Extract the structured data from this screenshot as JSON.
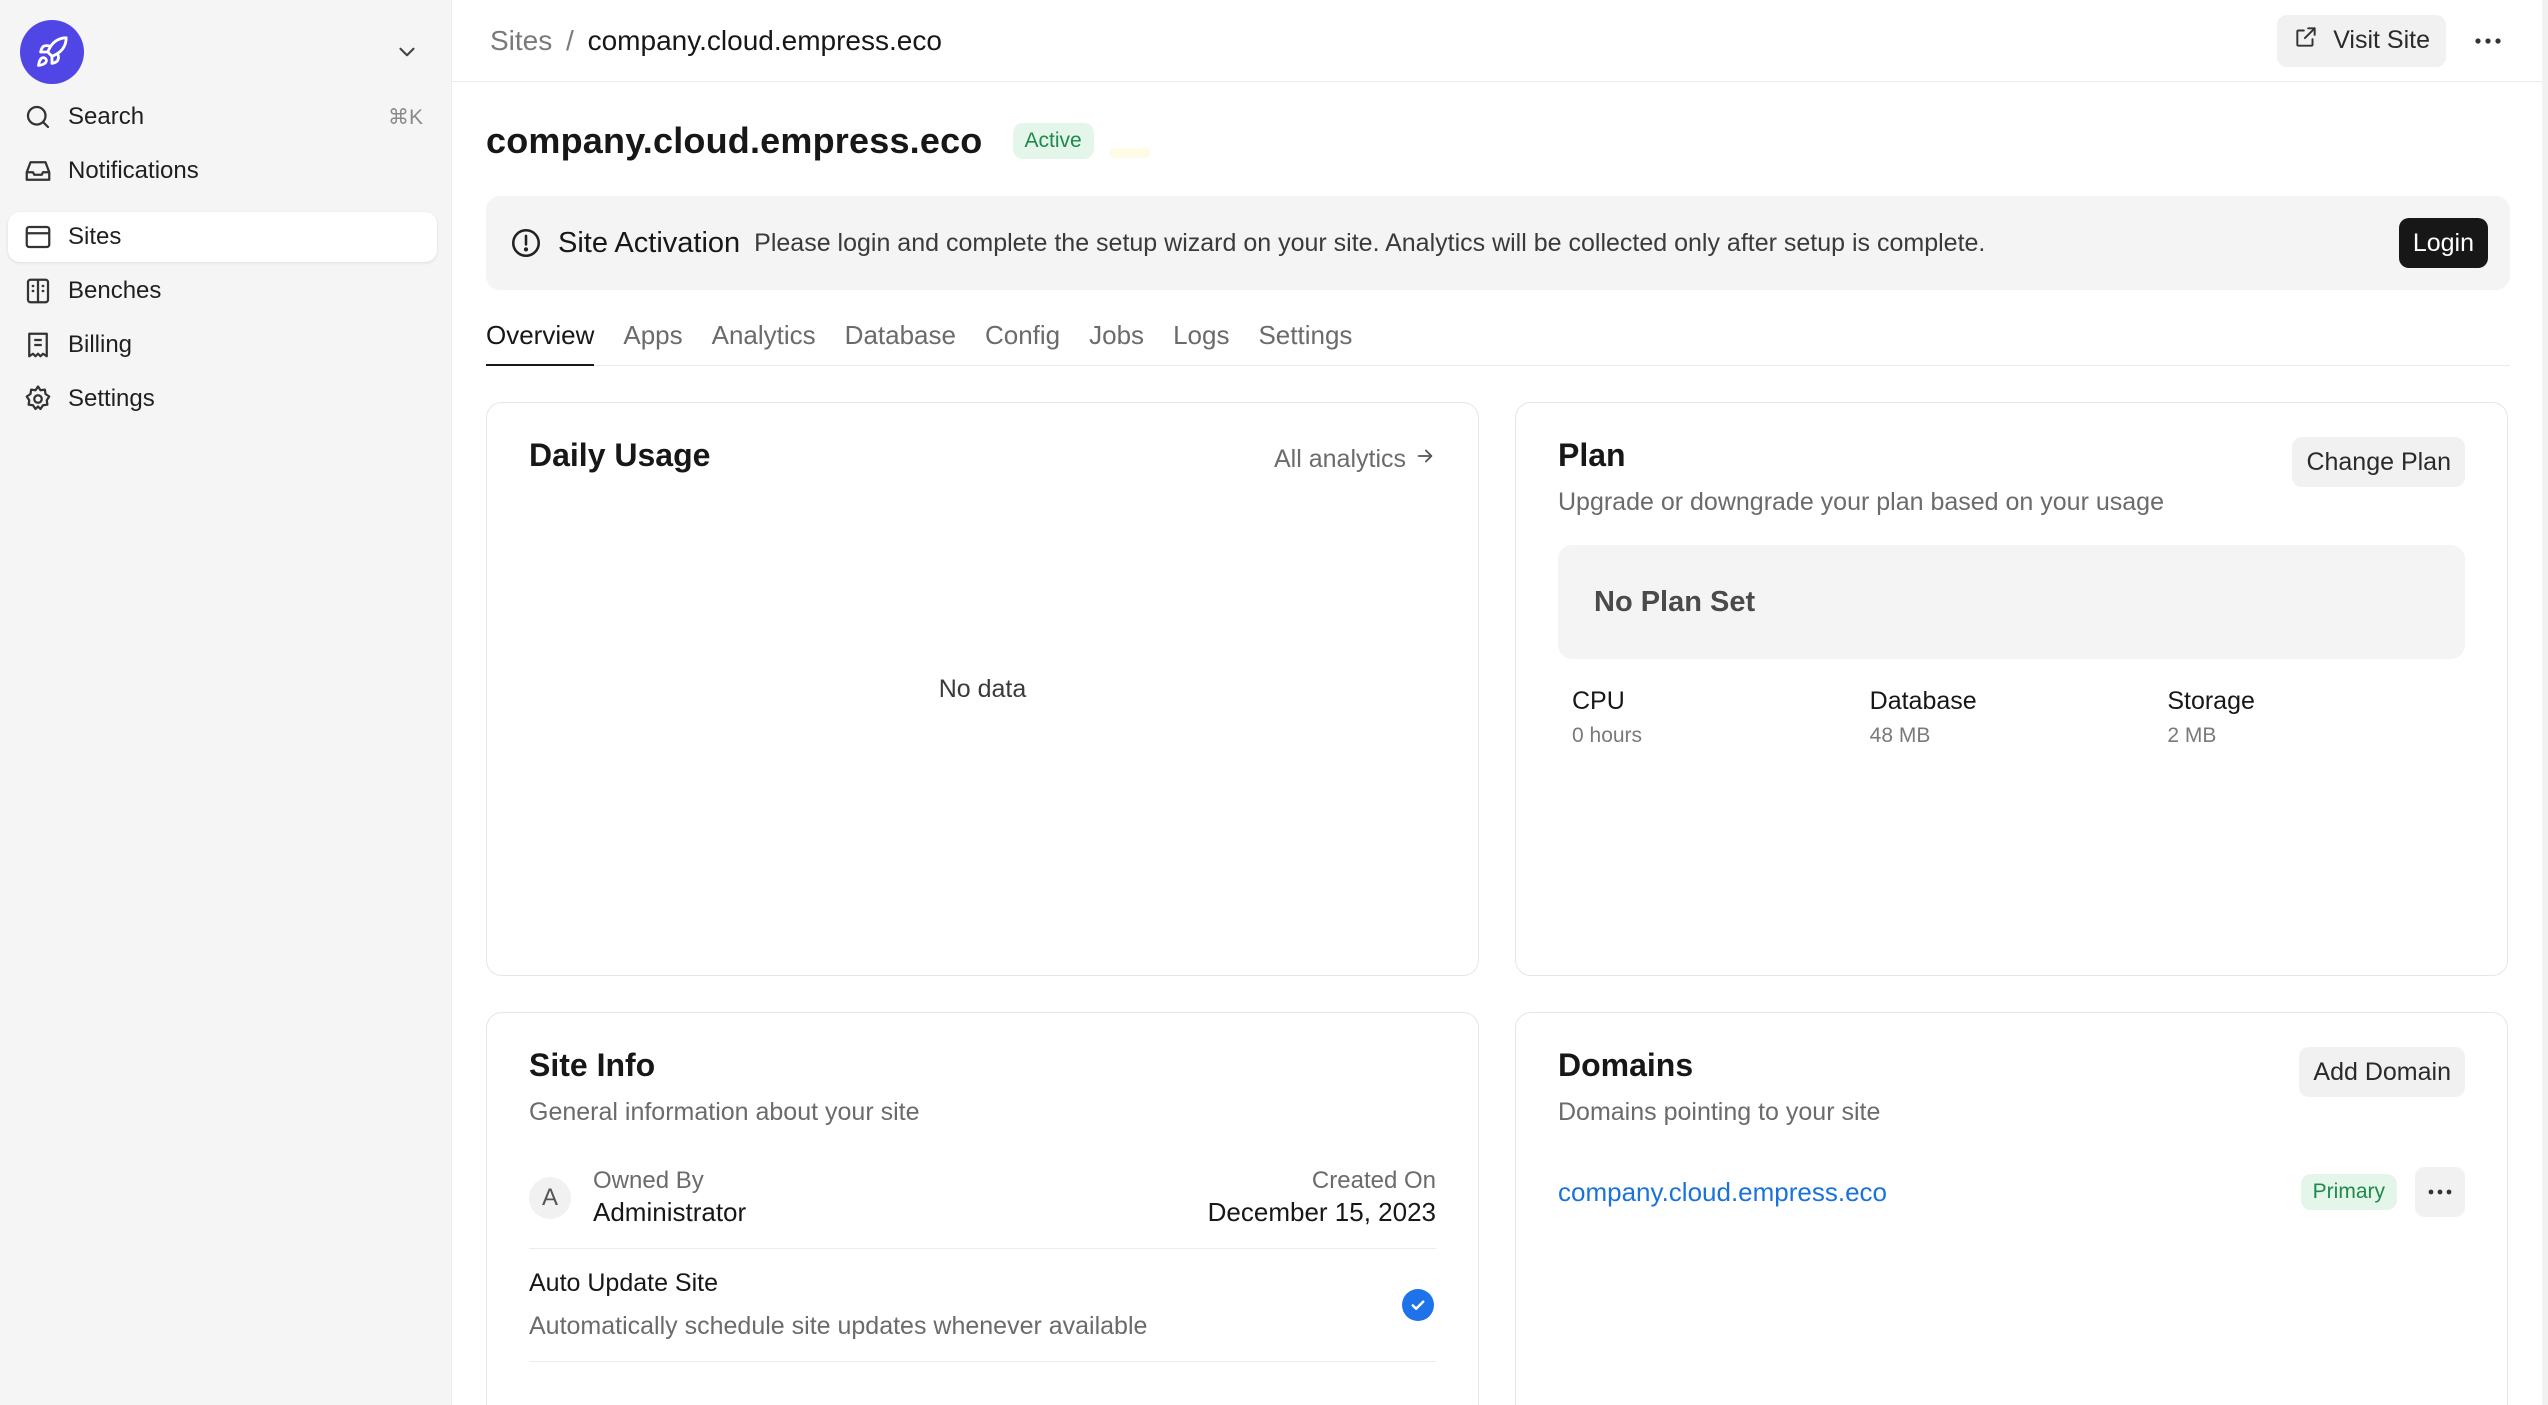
{
  "sidebar": {
    "logo_icon": "rocket-icon",
    "items": [
      {
        "label": "Search",
        "shortcut": "⌘K",
        "icon": "search-icon"
      },
      {
        "label": "Notifications",
        "icon": "inbox-icon"
      },
      {
        "label": "Sites",
        "icon": "browser-window-icon",
        "active": true
      },
      {
        "label": "Benches",
        "icon": "columns-icon"
      },
      {
        "label": "Billing",
        "icon": "receipt-icon"
      },
      {
        "label": "Settings",
        "icon": "gear-icon"
      }
    ]
  },
  "topbar": {
    "breadcrumb_root": "Sites",
    "breadcrumb_sep": "/",
    "breadcrumb_current": "company.cloud.empress.eco",
    "visit_label": "Visit Site"
  },
  "header": {
    "title": "company.cloud.empress.eco",
    "status": "Active"
  },
  "alert": {
    "title": "Site Activation",
    "message": "Please login and complete the setup wizard on your site. Analytics will be collected only after setup is complete.",
    "button": "Login"
  },
  "tabs": [
    "Overview",
    "Apps",
    "Analytics",
    "Database",
    "Config",
    "Jobs",
    "Logs",
    "Settings"
  ],
  "daily_usage": {
    "title": "Daily Usage",
    "link": "All analytics",
    "empty": "No data"
  },
  "plan": {
    "title": "Plan",
    "subtitle": "Upgrade or downgrade your plan based on your usage",
    "button": "Change Plan",
    "current": "No Plan Set",
    "usage": [
      {
        "label": "CPU",
        "value": "0 hours"
      },
      {
        "label": "Database",
        "value": "48 MB"
      },
      {
        "label": "Storage",
        "value": "2 MB"
      }
    ]
  },
  "site_info": {
    "title": "Site Info",
    "subtitle": "General information about your site",
    "avatar_initial": "A",
    "owned_by_label": "Owned By",
    "owned_by_value": "Administrator",
    "created_label": "Created On",
    "created_value": "December 15, 2023",
    "auto_update_title": "Auto Update Site",
    "auto_update_desc": "Automatically schedule site updates whenever available",
    "auto_update_enabled": true
  },
  "domains": {
    "title": "Domains",
    "subtitle": "Domains pointing to your site",
    "button": "Add Domain",
    "items": [
      {
        "name": "company.cloud.empress.eco",
        "badge": "Primary"
      }
    ]
  },
  "colors": {
    "brand": "#4f46e5",
    "success_bg": "#e4f5ea",
    "success_text": "#1f8a4c",
    "link": "#1a73d9",
    "check": "#1e73e8"
  }
}
